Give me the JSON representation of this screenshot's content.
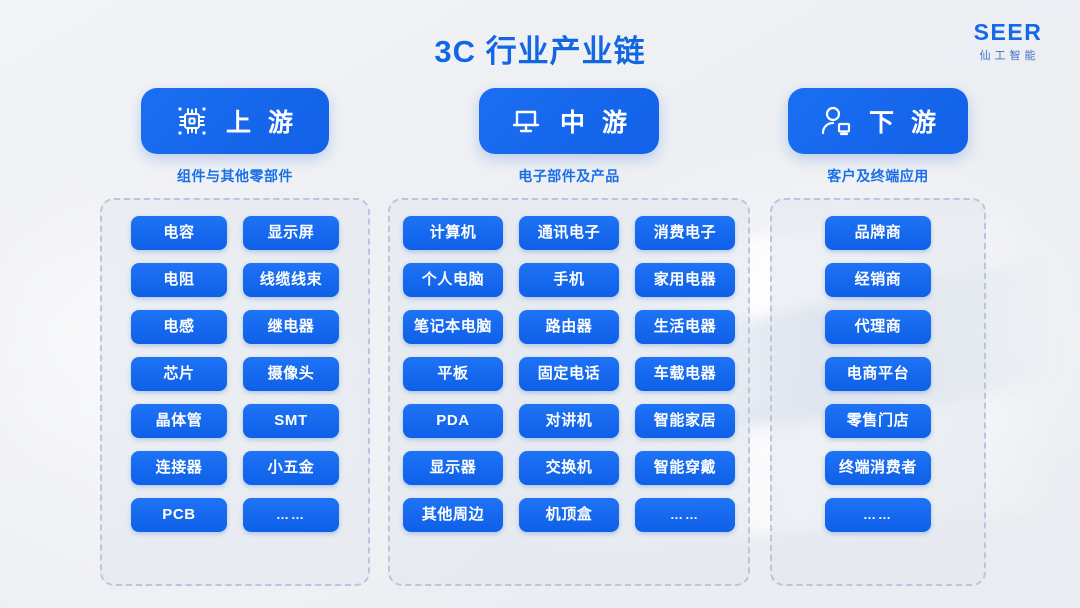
{
  "header": {
    "title": "3C 行业产业链",
    "logo_mark": "SEER",
    "logo_sub": "仙工智能",
    "accent_color": "#1367e3",
    "chip_color": "#1268ea",
    "dash_border_color": "#b9c6de"
  },
  "columns": [
    {
      "id": "upstream",
      "icon": "chip-icon",
      "label": "上 游",
      "subtitle": "组件与其他零部件",
      "rows": [
        [
          "电容",
          "显示屏"
        ],
        [
          "电阻",
          "线缆线束"
        ],
        [
          "电感",
          "继电器"
        ],
        [
          "芯片",
          "摄像头"
        ],
        [
          "晶体管",
          "SMT"
        ],
        [
          "连接器",
          "小五金"
        ],
        [
          "PCB",
          "……"
        ]
      ]
    },
    {
      "id": "midstream",
      "icon": "monitor-icon",
      "label": "中 游",
      "subtitle": "电子部件及产品",
      "rows": [
        [
          "计算机",
          "通讯电子",
          "消费电子"
        ],
        [
          "个人电脑",
          "手机",
          "家用电器"
        ],
        [
          "笔记本电脑",
          "路由器",
          "生活电器"
        ],
        [
          "平板",
          "固定电话",
          "车载电器"
        ],
        [
          "PDA",
          "对讲机",
          "智能家居"
        ],
        [
          "显示器",
          "交换机",
          "智能穿戴"
        ],
        [
          "其他周边",
          "机顶盒",
          "……"
        ]
      ]
    },
    {
      "id": "downstream",
      "icon": "user-device-icon",
      "label": "下 游",
      "subtitle": "客户及终端应用",
      "rows": [
        [
          "品牌商"
        ],
        [
          "经销商"
        ],
        [
          "代理商"
        ],
        [
          "电商平台"
        ],
        [
          "零售门店"
        ],
        [
          "终端消费者"
        ],
        [
          "……"
        ]
      ]
    }
  ]
}
